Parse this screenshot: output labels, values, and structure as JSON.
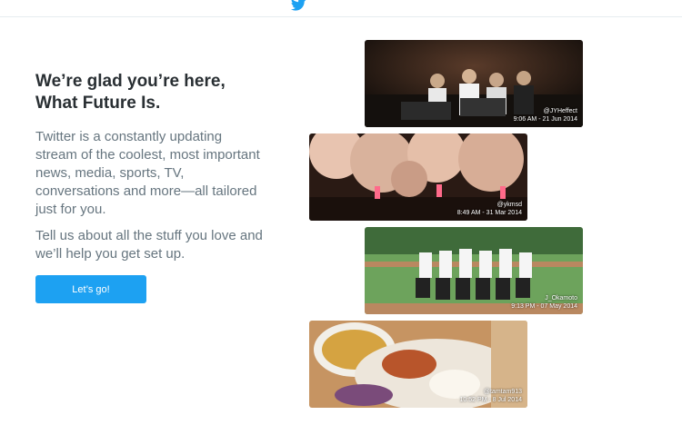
{
  "header": {
    "logo_icon": "twitter-bird-icon"
  },
  "welcome": {
    "headline_line1": "We’re glad you’re here,",
    "headline_line2": "What Future Is.",
    "description": "Twitter is a constantly updating stream of the coolest, most important news, media, sports, TV, conversations and more—all tailored just for you.",
    "prompt": "Tell us about all the stuff you love and we’ll help you get set up.",
    "cta_label": "Let’s go!"
  },
  "photos": [
    {
      "handle": "@JYHeffect",
      "timestamp": "9:06 AM - 21 Jun 2014"
    },
    {
      "handle": "@ykmsd",
      "timestamp": "8:49 AM - 31 Mar 2014"
    },
    {
      "handle": "J_Okamoto",
      "timestamp": "9:13 PM - 07 May 2014"
    },
    {
      "handle": "@tamtam913",
      "timestamp": "10:52 PM - 8 Jul 2014"
    }
  ],
  "colors": {
    "brand": "#1da1f2",
    "headline": "#292f33",
    "body_text": "#66757f"
  }
}
